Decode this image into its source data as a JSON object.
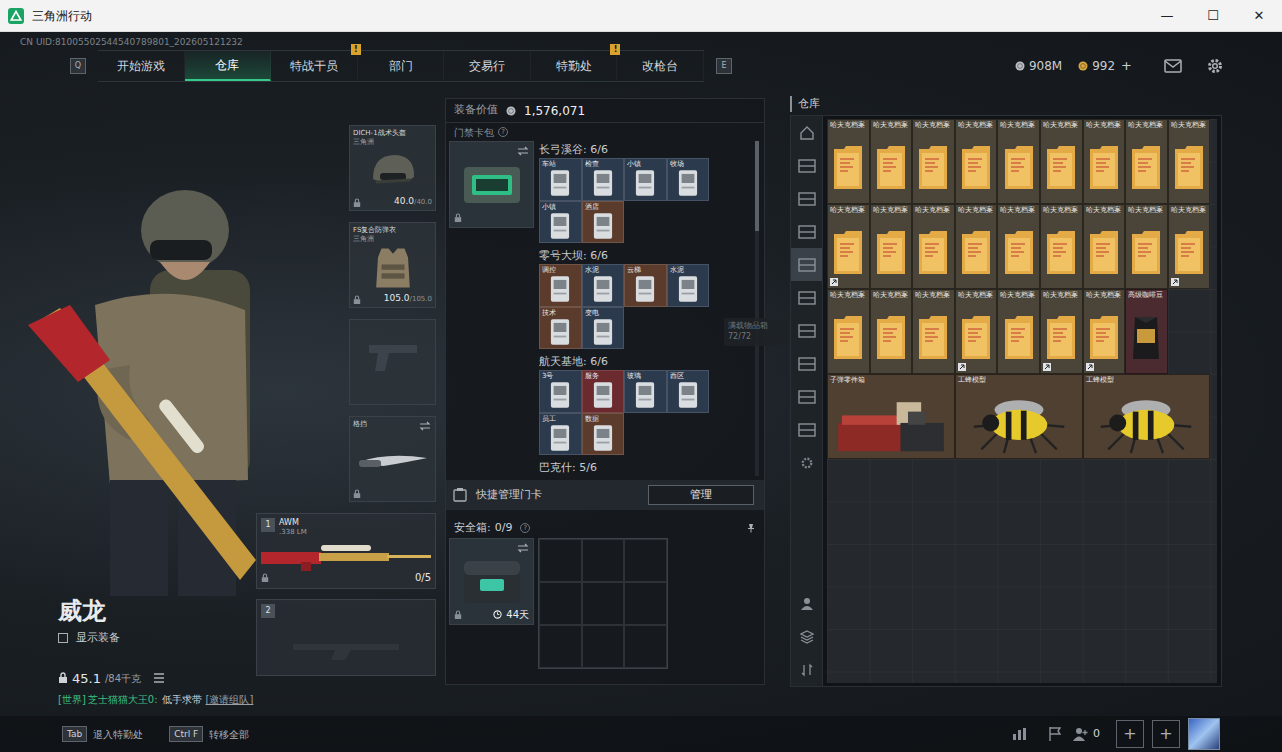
{
  "window": {
    "title": "三角洲行动",
    "controls": [
      "—",
      "☐",
      "✕"
    ]
  },
  "uid": "CN UID:81005502544540789801_202605121232",
  "nav": {
    "prev_key": "Q",
    "next_key": "E",
    "alert_glyph": "!",
    "tabs": [
      {
        "label": "开始游戏",
        "selected": false,
        "alert": false
      },
      {
        "label": "仓库",
        "selected": true,
        "alert": false
      },
      {
        "label": "特战干员",
        "selected": false,
        "alert": true
      },
      {
        "label": "部门",
        "selected": false,
        "alert": false
      },
      {
        "label": "交易行",
        "selected": false,
        "alert": false
      },
      {
        "label": "特勤处",
        "selected": false,
        "alert": true
      },
      {
        "label": "改枪台",
        "selected": false,
        "alert": false
      }
    ]
  },
  "currencies": [
    {
      "amount": "908M",
      "color": "#b8bec4"
    },
    {
      "amount": "992",
      "color": "#d9a640"
    }
  ],
  "currency_add": "+",
  "character": {
    "name": "威龙",
    "show_equipment": {
      "label": "显示装备",
      "checked": false
    },
    "weight": {
      "current": "45.1",
      "max": "/84千克"
    },
    "chat": {
      "channel": "[世界]",
      "sender": "芝士猫猫大王0:",
      "message": "低手求带",
      "action": "[邀请组队]"
    }
  },
  "gear": [
    {
      "kind": "helmet",
      "name": "DICH-1战术头盔",
      "maker": "三角洲",
      "durability": "40.0",
      "max": "/40.0"
    },
    {
      "kind": "armor",
      "name": "FS复合防弹衣",
      "maker": "三角洲",
      "durability": "105.0",
      "max": "/105.0"
    },
    {
      "kind": "pistol"
    },
    {
      "kind": "melee",
      "name": "格挡"
    }
  ],
  "weapons": [
    {
      "slot": "1",
      "name": "AWM",
      "caliber": ".338 LM",
      "ammo": "0/5"
    },
    {
      "slot": "2"
    }
  ],
  "loadout": {
    "value_label": "装备价值",
    "value": "1,576,071",
    "card_pack": {
      "title": "门禁卡包",
      "help": "?",
      "maps": [
        {
          "name": "长弓溪谷: 6/6",
          "cards": [
            {
              "label": "车站",
              "color": "#2c3a4d"
            },
            {
              "label": "检查",
              "color": "#2c3a4d"
            },
            {
              "label": "小镇",
              "color": "#2c3a4d"
            },
            {
              "label": "牧场",
              "color": "#2c3a4d"
            },
            {
              "label": "小镇",
              "color": "#2c3a4d"
            },
            {
              "label": "酒店",
              "color": "#5b3b2c"
            }
          ]
        },
        {
          "name": "零号大坝: 6/6",
          "cards": [
            {
              "label": "调控",
              "color": "#5b3b2c"
            },
            {
              "label": "水泥",
              "color": "#2c3a4d"
            },
            {
              "label": "云梯",
              "color": "#5b3b2c"
            },
            {
              "label": "水泥",
              "color": "#2c3a4d"
            },
            {
              "label": "技术",
              "color": "#5b3b2c"
            },
            {
              "label": "变电",
              "color": "#2c3a4d"
            }
          ]
        },
        {
          "name": "航天基地: 6/6",
          "cards": [
            {
              "label": "3号",
              "color": "#2c3a4d"
            },
            {
              "label": "服务",
              "color": "#6b2a2e"
            },
            {
              "label": "玻璃",
              "color": "#2c3a4d"
            },
            {
              "label": "西区",
              "color": "#2c3a4d"
            },
            {
              "label": "员工",
              "color": "#2c3a4d"
            },
            {
              "label": "数据",
              "color": "#5b3b2c"
            }
          ]
        },
        {
          "name": "巴克什: 5/6",
          "cards": []
        }
      ]
    },
    "quick_manage": {
      "label": "快捷管理门卡",
      "button": "管理"
    },
    "safe_box": {
      "label": "安全箱:",
      "count": "0/9",
      "help": "?",
      "expires": "44天"
    }
  },
  "tooltip": {
    "title": "满载物品箱",
    "count": "72/72"
  },
  "warehouse": {
    "title": "仓库",
    "tabs": [
      {
        "selected": false
      },
      {
        "selected": false
      },
      {
        "selected": false
      },
      {
        "selected": true
      },
      {
        "selected": false
      },
      {
        "selected": false
      },
      {
        "selected": false
      },
      {
        "selected": false
      },
      {
        "selected": false
      }
    ],
    "items": [
      {
        "name": "哈夫克档案",
        "kind": "document",
        "marked": false
      },
      {
        "name": "哈夫克档案",
        "kind": "document",
        "marked": false
      },
      {
        "name": "哈夫克档案",
        "kind": "document",
        "marked": false
      },
      {
        "name": "哈夫克档案",
        "kind": "document",
        "marked": false
      },
      {
        "name": "哈夫克档案",
        "kind": "document",
        "marked": false
      },
      {
        "name": "哈夫克档案",
        "kind": "document",
        "marked": false
      },
      {
        "name": "哈夫克档案",
        "kind": "document",
        "marked": false
      },
      {
        "name": "哈夫克档案",
        "kind": "document",
        "marked": false
      },
      {
        "name": "哈夫克档案",
        "kind": "document",
        "marked": false
      },
      {
        "name": "哈夫克档案",
        "kind": "document",
        "marked": true
      },
      {
        "name": "哈夫克档案",
        "kind": "document",
        "marked": false
      },
      {
        "name": "哈夫克档案",
        "kind": "document",
        "marked": false
      },
      {
        "name": "哈夫克档案",
        "kind": "document",
        "marked": false
      },
      {
        "name": "哈夫克档案",
        "kind": "document",
        "marked": false
      },
      {
        "name": "哈夫克档案",
        "kind": "document",
        "marked": false
      },
      {
        "name": "哈夫克档案",
        "kind": "document",
        "marked": false
      },
      {
        "name": "哈夫克档案",
        "kind": "document",
        "marked": false
      },
      {
        "name": "哈夫克档案",
        "kind": "document",
        "marked": true
      },
      {
        "name": "哈夫克档案",
        "kind": "document",
        "marked": false
      },
      {
        "name": "哈夫克档案",
        "kind": "document",
        "marked": false
      },
      {
        "name": "哈夫克档案",
        "kind": "document",
        "marked": false
      },
      {
        "name": "哈夫克档案",
        "kind": "document",
        "marked": true
      },
      {
        "name": "哈夫克档案",
        "kind": "document",
        "marked": false
      },
      {
        "name": "哈夫克档案",
        "kind": "document",
        "marked": true
      },
      {
        "name": "哈夫克档案",
        "kind": "document",
        "marked": true
      },
      {
        "name": "高级咖啡豆",
        "kind": "coffee",
        "marked": false
      },
      {
        "name": "子弹零件箱",
        "kind": "crate",
        "marked": false
      },
      {
        "name": "工蜂模型",
        "kind": "bee",
        "marked": false
      },
      {
        "name": "工蜂模型",
        "kind": "bee",
        "marked": false
      }
    ]
  },
  "bottom": {
    "hints": [
      {
        "key": "Tab",
        "label": "退入特勤处"
      },
      {
        "key": "Ctrl F",
        "label": "转移全部"
      }
    ],
    "friends": "0",
    "add_buttons": [
      "+",
      "+"
    ]
  }
}
